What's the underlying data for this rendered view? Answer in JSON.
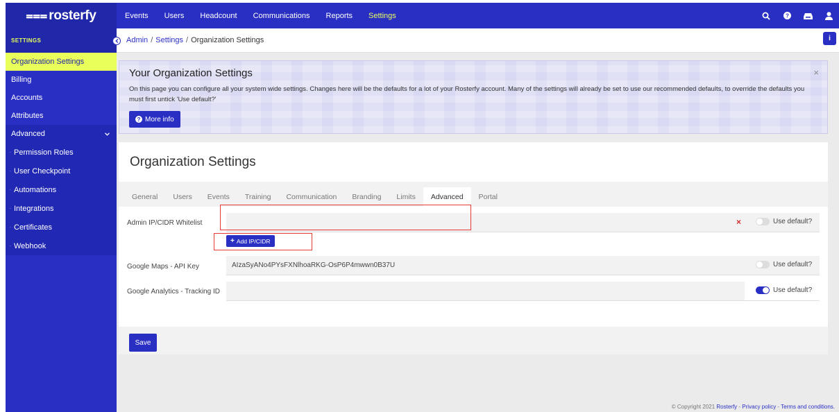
{
  "brand": {
    "name": "rosterfy",
    "mark": "⩶"
  },
  "topnav": {
    "items": [
      {
        "label": "Events"
      },
      {
        "label": "Users"
      },
      {
        "label": "Headcount"
      },
      {
        "label": "Communications"
      },
      {
        "label": "Reports"
      },
      {
        "label": "Settings"
      }
    ],
    "active": "Settings",
    "icons": [
      "search-icon",
      "help-icon",
      "inbox-icon",
      "user-icon"
    ]
  },
  "sidebar": {
    "heading": "SETTINGS",
    "items": [
      {
        "label": "Organization Settings"
      },
      {
        "label": "Billing"
      },
      {
        "label": "Accounts"
      },
      {
        "label": "Attributes"
      },
      {
        "label": "Advanced"
      }
    ],
    "subitems": [
      {
        "label": "Permission Roles"
      },
      {
        "label": "User Checkpoint"
      },
      {
        "label": "Automations"
      },
      {
        "label": "Integrations"
      },
      {
        "label": "Certificates"
      },
      {
        "label": "Webhook"
      }
    ]
  },
  "breadcrumb": {
    "admin": "Admin",
    "settings": "Settings",
    "current": "Organization Settings"
  },
  "banner": {
    "title": "Your Organization Settings",
    "text": "On this page you can configure all your system wide settings. Changes here will be the defaults for a lot of your Rosterfy account. Many of the settings will already be set to use our recommended defaults, to override the defaults you must first untick 'Use default?'",
    "more_info": "More info",
    "close": "×"
  },
  "page": {
    "title": "Organization Settings",
    "tabs": [
      {
        "label": "General"
      },
      {
        "label": "Users"
      },
      {
        "label": "Events"
      },
      {
        "label": "Training"
      },
      {
        "label": "Communication"
      },
      {
        "label": "Branding"
      },
      {
        "label": "Limits"
      },
      {
        "label": "Advanced"
      },
      {
        "label": "Portal"
      }
    ],
    "active_tab": "Advanced"
  },
  "form": {
    "whitelist": {
      "label": "Admin IP/CIDR Whitelist",
      "value": "",
      "use_default": false,
      "use_default_label": "Use default?",
      "remove": "×"
    },
    "add_button": "Add IP/CIDR",
    "maps": {
      "label": "Google Maps - API Key",
      "value": "AIzaSyANo4PYsFXNlhoaRKG-OsP6P4mwwn0B37U",
      "use_default": false,
      "use_default_label": "Use default?"
    },
    "analytics": {
      "label": "Google Analytics - Tracking ID",
      "value": "",
      "use_default": true,
      "use_default_label": "Use default?"
    },
    "save": "Save"
  },
  "footer": {
    "copyright": "© Copyright 2021",
    "brand": "Rosterfy",
    "privacy": "Privacy policy",
    "terms": "Terms and conditions."
  },
  "colors": {
    "primary": "#2a2fc4",
    "accent": "#e9ff5a",
    "highlight": "#e53935"
  }
}
